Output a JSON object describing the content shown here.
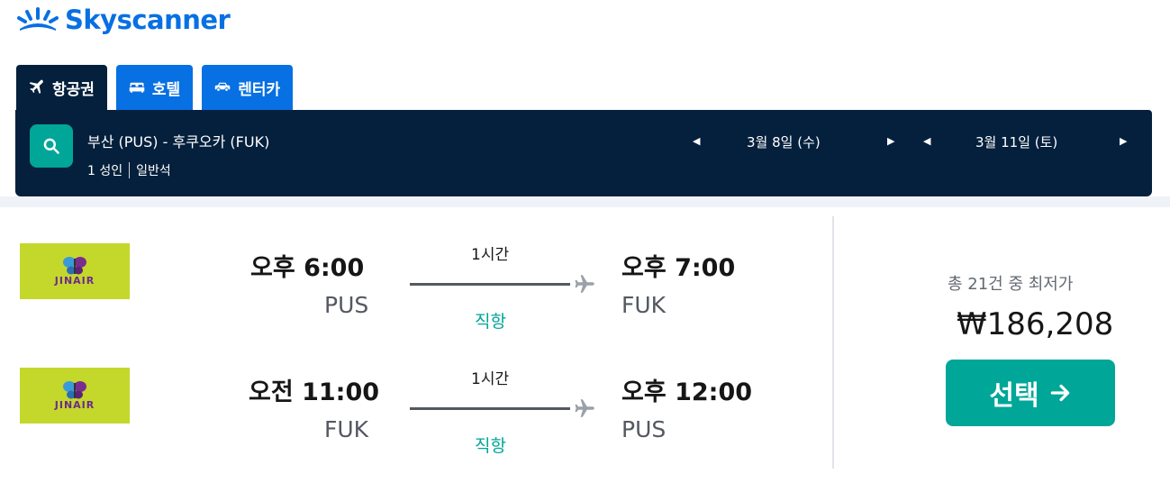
{
  "brand": {
    "name": "Skyscanner"
  },
  "tabs": [
    {
      "label": "항공권",
      "icon": "plane-icon",
      "active": true
    },
    {
      "label": "호텔",
      "icon": "bed-icon",
      "active": false
    },
    {
      "label": "렌터카",
      "icon": "car-icon",
      "active": false
    }
  ],
  "search": {
    "route": "부산 (PUS) - 후쿠오카 (FUK)",
    "passengers": "1 성인",
    "cabin": "일반석",
    "depart_date": "3월 8일 (수)",
    "return_date": "3월 11일 (토)"
  },
  "legs": [
    {
      "airline": "JINAIR",
      "depart_time": "오후 6:00",
      "depart_code": "PUS",
      "duration": "1시간",
      "stops": "직항",
      "arrive_time": "오후 7:00",
      "arrive_code": "FUK"
    },
    {
      "airline": "JINAIR",
      "depart_time": "오전 11:00",
      "depart_code": "FUK",
      "duration": "1시간",
      "stops": "직항",
      "arrive_time": "오후 12:00",
      "arrive_code": "PUS"
    }
  ],
  "offer": {
    "label": "총 21건 중 최저가",
    "price": "₩186,208",
    "select_label": "선택"
  },
  "colors": {
    "brand_blue": "#0770e3",
    "navy": "#05203c",
    "teal": "#00a698",
    "jinair_green": "#c4d72b"
  }
}
